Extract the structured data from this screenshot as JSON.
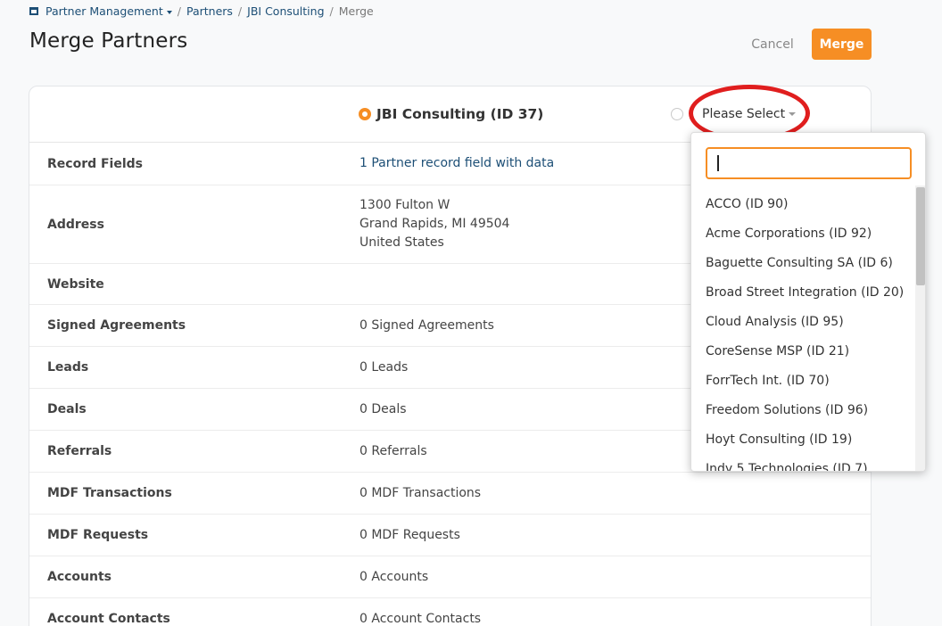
{
  "breadcrumb": {
    "icon": "building-icon",
    "items": [
      "Partner Management",
      "Partners",
      "JBI Consulting"
    ],
    "separator": "/",
    "current": "Merge"
  },
  "page": {
    "title": "Merge Partners",
    "cancel_label": "Cancel",
    "merge_label": "Merge"
  },
  "colors": {
    "accent": "#f68e24",
    "link": "#1d4f76",
    "annotation": "#e01e1e"
  },
  "header": {
    "primary_partner": "JBI Consulting (ID 37)",
    "select_placeholder": "Please Select"
  },
  "rows": [
    {
      "label": "Record Fields",
      "value": "1 Partner record field with data"
    },
    {
      "label": "Address",
      "lines": [
        "1300 Fulton W",
        "Grand Rapids, MI 49504",
        "United States"
      ]
    },
    {
      "label": "Website",
      "value": ""
    },
    {
      "label": "Signed Agreements",
      "value": "0 Signed Agreements"
    },
    {
      "label": "Leads",
      "value": "0 Leads"
    },
    {
      "label": "Deals",
      "value": "0 Deals"
    },
    {
      "label": "Referrals",
      "value": "0 Referrals"
    },
    {
      "label": "MDF Transactions",
      "value": "0 MDF Transactions"
    },
    {
      "label": "MDF Requests",
      "value": "0 MDF Requests"
    },
    {
      "label": "Accounts",
      "value": "0 Accounts"
    },
    {
      "label": "Account Contacts",
      "value": "0 Account Contacts"
    }
  ],
  "dropdown": {
    "search_value": "",
    "options": [
      "ACCO (ID 90)",
      "Acme Corporations (ID 92)",
      "Baguette Consulting SA (ID 6)",
      "Broad Street Integration (ID 20)",
      "Cloud Analysis (ID 95)",
      "CoreSense MSP (ID 21)",
      "ForrTech Int. (ID 70)",
      "Freedom Solutions (ID 96)",
      "Hoyt Consulting (ID 19)",
      "Indy 5 Technologies (ID 7)"
    ]
  }
}
